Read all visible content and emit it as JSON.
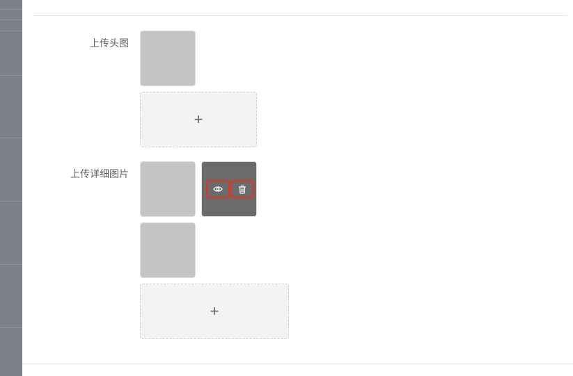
{
  "form": {
    "avatar_label": "上传头图",
    "details_label": "上传详细图片",
    "upload_plus": "+"
  },
  "images": {
    "avatar": [
      {
        "name": "avatar-photo-1"
      }
    ],
    "details": [
      {
        "name": "detail-photo-1"
      },
      {
        "name": "detail-photo-2",
        "hover_actions": [
          "eye-icon",
          "trash-icon"
        ]
      },
      {
        "name": "detail-photo-3"
      }
    ]
  },
  "colors": {
    "action_highlight": "#e8321f",
    "upload_bg": "#f2f3f5",
    "overlay_strip": "#7c7f85"
  }
}
